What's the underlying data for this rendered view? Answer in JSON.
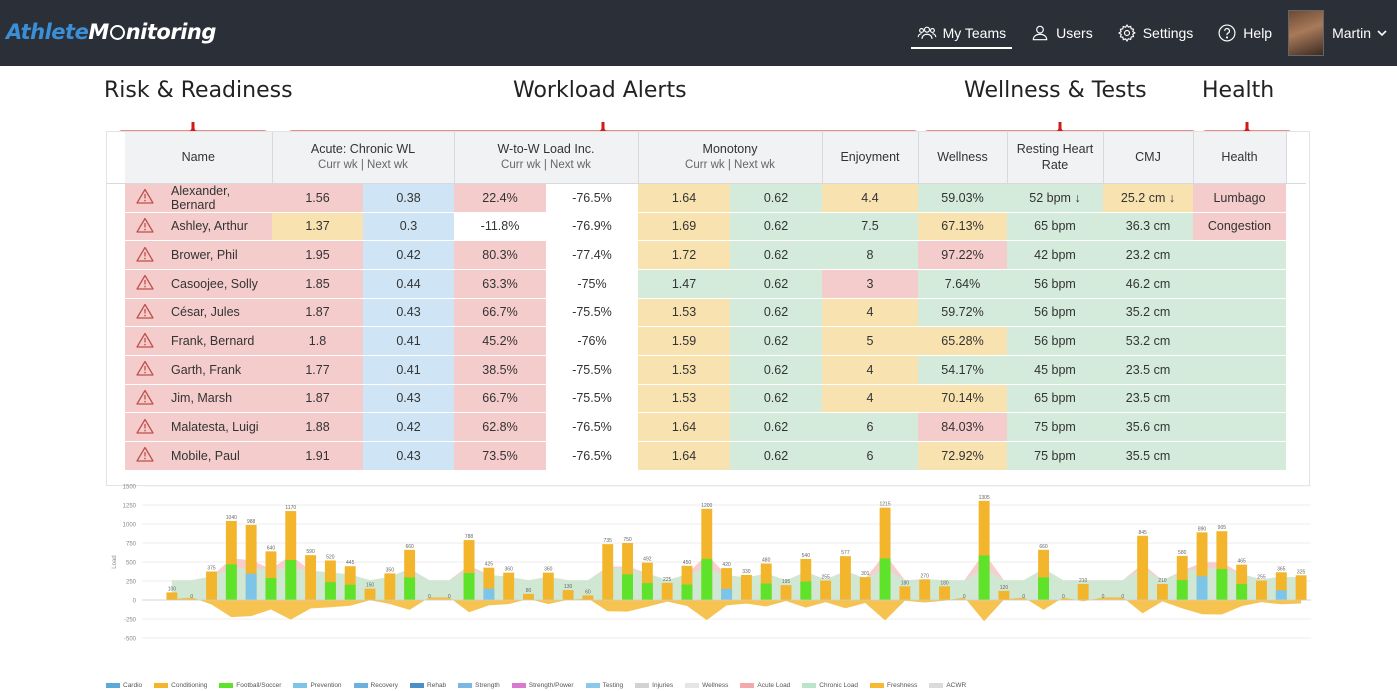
{
  "app": {
    "logo_part1": "Athlete",
    "logo_part2": "M",
    "logo_part3": "nitoring"
  },
  "nav": {
    "items": [
      {
        "label": "My Teams",
        "icon": "teams-icon",
        "active": true
      },
      {
        "label": "Users",
        "icon": "user-icon"
      },
      {
        "label": "Settings",
        "icon": "gear-icon"
      },
      {
        "label": "Help",
        "icon": "help-icon"
      }
    ],
    "user_name": "Martin"
  },
  "sections": {
    "risk": "Risk & Readiness",
    "workload": "Workload Alerts",
    "wellness": "Wellness & Tests",
    "health": "Health"
  },
  "table": {
    "headers": {
      "name": "Name",
      "acwl": "Acute: Chronic WL",
      "acwl_sub": "Curr wk | Next wk",
      "wtow": "W-to-W Load Inc.",
      "wtow_sub": "Curr wk | Next wk",
      "monotony": "Monotony",
      "monotony_sub": "Curr wk | Next wk",
      "enjoyment": "Enjoyment",
      "wellness": "Wellness",
      "rhr": "Resting Heart Rate",
      "cmj": "CMJ",
      "health": "Health"
    },
    "rows": [
      {
        "name": "Alexander, Bernard",
        "ac1": "1.56",
        "ac2": "0.38",
        "w1": "22.4%",
        "w2": "-76.5%",
        "m1": "1.64",
        "m2": "0.62",
        "enj": "4.4",
        "well": "59.03%",
        "rhr": "52 bpm ↓",
        "cmj": "25.2 cm ↓",
        "health": "Lumbago",
        "c": [
          "r",
          "b",
          "r",
          "w",
          "y",
          "g",
          "y",
          "g",
          "g",
          "y",
          "r"
        ]
      },
      {
        "name": "Ashley, Arthur",
        "ac1": "1.37",
        "ac2": "0.3",
        "w1": "-11.8%",
        "w2": "-76.9%",
        "m1": "1.69",
        "m2": "0.62",
        "enj": "7.5",
        "well": "67.13%",
        "rhr": "65 bpm",
        "cmj": "36.3 cm",
        "health": "Congestion",
        "c": [
          "y",
          "b",
          "w",
          "w",
          "y",
          "g",
          "g",
          "y",
          "g",
          "g",
          "r"
        ]
      },
      {
        "name": "Brower, Phil",
        "ac1": "1.95",
        "ac2": "0.42",
        "w1": "80.3%",
        "w2": "-77.4%",
        "m1": "1.72",
        "m2": "0.62",
        "enj": "8",
        "well": "97.22%",
        "rhr": "42 bpm",
        "cmj": "23.2 cm",
        "health": "",
        "c": [
          "r",
          "b",
          "r",
          "w",
          "y",
          "g",
          "g",
          "r",
          "g",
          "g",
          "g"
        ]
      },
      {
        "name": "Casoojee, Solly",
        "ac1": "1.85",
        "ac2": "0.44",
        "w1": "63.3%",
        "w2": "-75%",
        "m1": "1.47",
        "m2": "0.62",
        "enj": "3",
        "well": "7.64%",
        "rhr": "56 bpm",
        "cmj": "46.2 cm",
        "health": "",
        "c": [
          "r",
          "b",
          "r",
          "w",
          "g",
          "g",
          "r",
          "g",
          "g",
          "g",
          "g"
        ]
      },
      {
        "name": "César, Jules",
        "ac1": "1.87",
        "ac2": "0.43",
        "w1": "66.7%",
        "w2": "-75.5%",
        "m1": "1.53",
        "m2": "0.62",
        "enj": "4",
        "well": "59.72%",
        "rhr": "56 bpm",
        "cmj": "35.2 cm",
        "health": "",
        "c": [
          "r",
          "b",
          "r",
          "w",
          "y",
          "g",
          "y",
          "g",
          "g",
          "g",
          "g"
        ]
      },
      {
        "name": "Frank, Bernard",
        "ac1": "1.8",
        "ac2": "0.41",
        "w1": "45.2%",
        "w2": "-76%",
        "m1": "1.59",
        "m2": "0.62",
        "enj": "5",
        "well": "65.28%",
        "rhr": "56 bpm",
        "cmj": "53.2 cm",
        "health": "",
        "c": [
          "r",
          "b",
          "r",
          "w",
          "y",
          "g",
          "y",
          "y",
          "g",
          "g",
          "g"
        ]
      },
      {
        "name": "Garth, Frank",
        "ac1": "1.77",
        "ac2": "0.41",
        "w1": "38.5%",
        "w2": "-75.5%",
        "m1": "1.53",
        "m2": "0.62",
        "enj": "4",
        "well": "54.17%",
        "rhr": "45 bpm",
        "cmj": "23.5 cm",
        "health": "",
        "c": [
          "r",
          "b",
          "r",
          "w",
          "y",
          "g",
          "y",
          "g",
          "g",
          "g",
          "g"
        ]
      },
      {
        "name": "Jim, Marsh",
        "ac1": "1.87",
        "ac2": "0.43",
        "w1": "66.7%",
        "w2": "-75.5%",
        "m1": "1.53",
        "m2": "0.62",
        "enj": "4",
        "well": "70.14%",
        "rhr": "65 bpm",
        "cmj": "23.5 cm",
        "health": "",
        "c": [
          "r",
          "b",
          "r",
          "w",
          "y",
          "g",
          "y",
          "y",
          "g",
          "g",
          "g"
        ]
      },
      {
        "name": "Malatesta, Luigi",
        "ac1": "1.88",
        "ac2": "0.42",
        "w1": "62.8%",
        "w2": "-76.5%",
        "m1": "1.64",
        "m2": "0.62",
        "enj": "6",
        "well": "84.03%",
        "rhr": "75 bpm",
        "cmj": "35.6 cm",
        "health": "",
        "c": [
          "r",
          "b",
          "r",
          "w",
          "y",
          "g",
          "g",
          "r",
          "g",
          "g",
          "g"
        ]
      },
      {
        "name": "Mobile, Paul",
        "ac1": "1.91",
        "ac2": "0.43",
        "w1": "73.5%",
        "w2": "-76.5%",
        "m1": "1.64",
        "m2": "0.62",
        "enj": "6",
        "well": "72.92%",
        "rhr": "75 bpm",
        "cmj": "35.5 cm",
        "health": "",
        "c": [
          "r",
          "b",
          "r",
          "w",
          "y",
          "g",
          "g",
          "y",
          "g",
          "g",
          "g"
        ]
      }
    ]
  },
  "chart_data": {
    "type": "bar",
    "ylim": [
      -500,
      1500
    ],
    "yticks": [
      "1500",
      "1250",
      "1000",
      "750",
      "500",
      "250",
      "0",
      "-250",
      "-500"
    ],
    "ylabel": "Load",
    "values": [
      100,
      0,
      375,
      1040,
      988,
      640,
      1170,
      590,
      520,
      445,
      150,
      350,
      660,
      0,
      0,
      788,
      425,
      360,
      80,
      360,
      130,
      60,
      735,
      750,
      492,
      225,
      450,
      1200,
      420,
      330,
      480,
      195,
      540,
      255,
      577,
      301,
      1215,
      180,
      270,
      180,
      0,
      1305,
      120,
      0,
      660,
      0,
      210,
      0,
      0,
      845,
      210,
      580,
      890,
      905,
      465,
      255,
      365,
      325
    ],
    "series": [
      {
        "name": "Cardio",
        "color": "#5aa9d6"
      },
      {
        "name": "Conditioning",
        "color": "#f2b52b"
      },
      {
        "name": "Football/Soccer",
        "color": "#5ee22a"
      },
      {
        "name": "Prevention",
        "color": "#7cc5e8"
      },
      {
        "name": "Recovery",
        "color": "#6ab0e0"
      },
      {
        "name": "Rehab",
        "color": "#4a8fc8"
      },
      {
        "name": "Strength",
        "color": "#7ab7e2"
      },
      {
        "name": "Strength/Power",
        "color": "#d77ad0"
      },
      {
        "name": "Testing",
        "color": "#8bc9ea"
      },
      {
        "name": "Injuries",
        "color": "#cfd3d6"
      },
      {
        "name": "Wellness",
        "color": "#e3e5e7"
      },
      {
        "name": "Acute Load",
        "color": "#f3a9a9"
      },
      {
        "name": "Chronic Load",
        "color": "#b9e6c8"
      },
      {
        "name": "Freshness",
        "color": "#f6b931"
      },
      {
        "name": "ACWR",
        "color": "#d9dbdd"
      }
    ]
  }
}
